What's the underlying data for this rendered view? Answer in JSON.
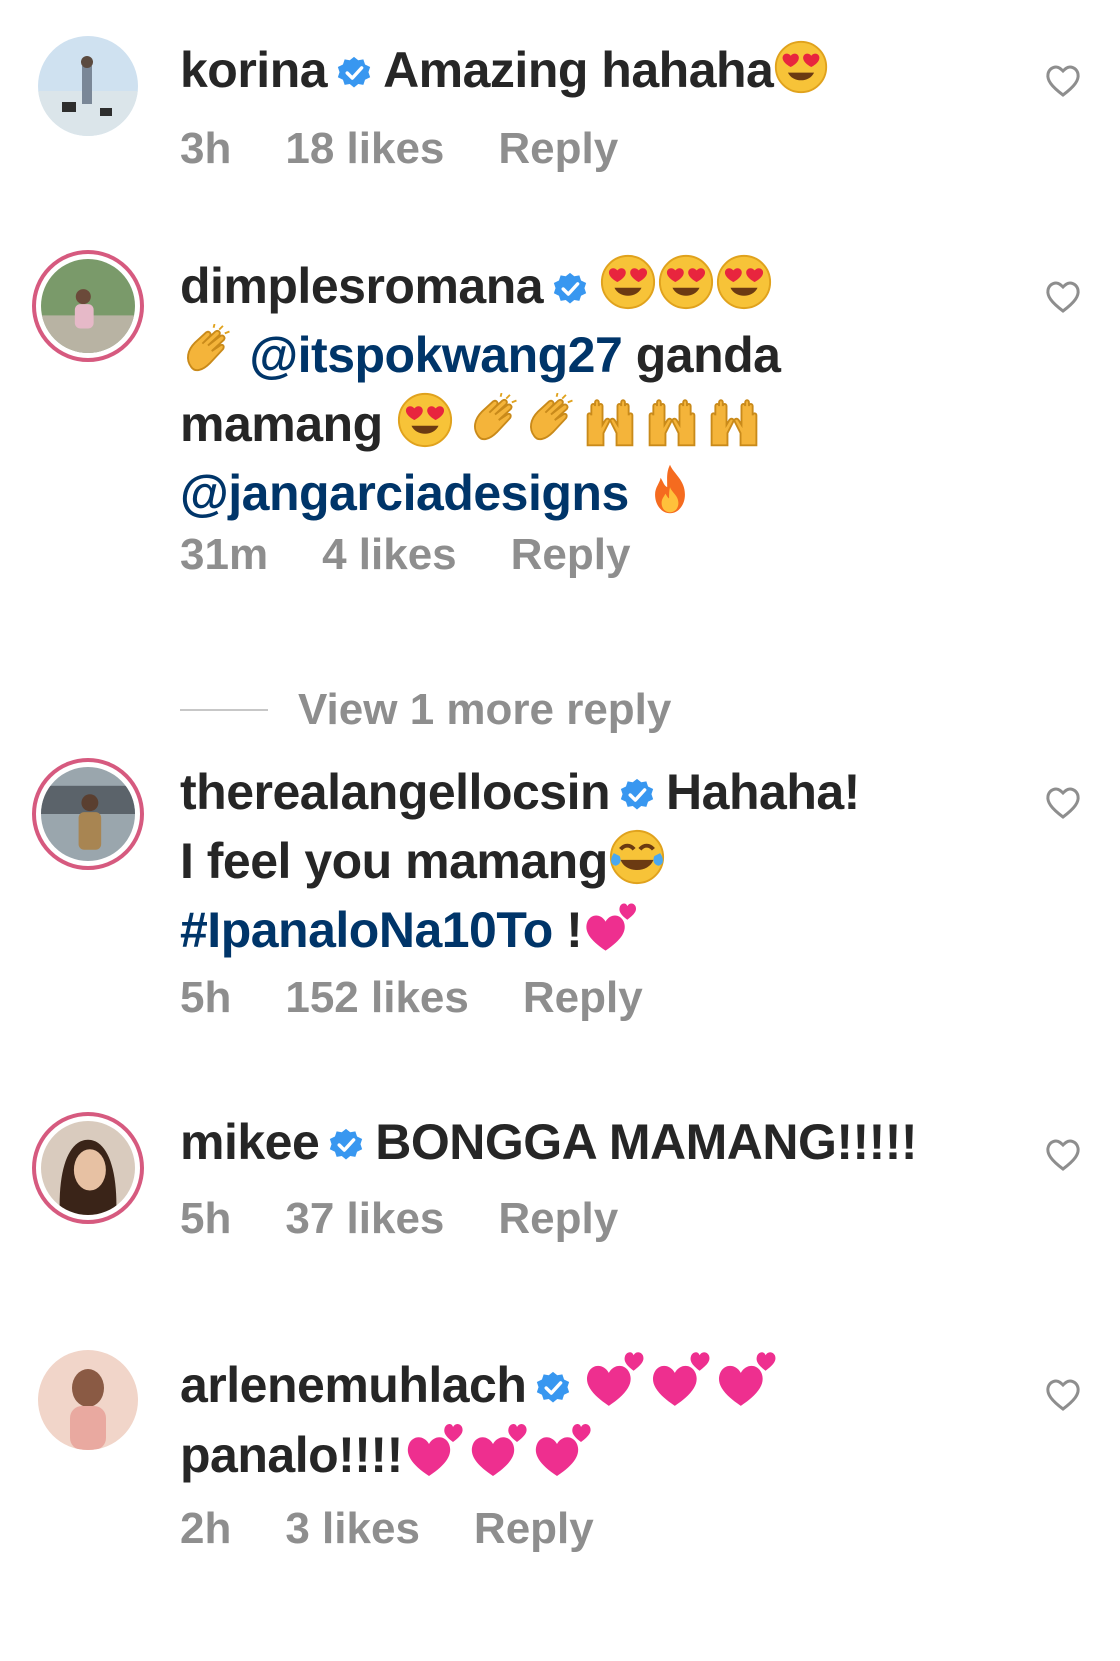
{
  "colors": {
    "meta": "#8e8e8e",
    "mention": "#003569",
    "verified": "#3897f0",
    "ring": "#d65a7f"
  },
  "comments": [
    {
      "username": "korina",
      "text": "Amazing hahaha",
      "emoji": [
        "heart-eyes"
      ],
      "time": "3h",
      "likes": "18 likes",
      "reply": "Reply"
    },
    {
      "username": "dimplesromana",
      "emoji_lead": [
        "heart-eyes",
        "heart-eyes",
        "heart-eyes"
      ],
      "mention1": "@itspokwang27",
      "text1": "ganda",
      "text2": "mamang",
      "mention2": "@jangarciadesigns",
      "time": "31m",
      "likes": "4 likes",
      "reply": "Reply"
    },
    {
      "username": "therealangellocsin",
      "text1": "Hahaha!",
      "text2": "I feel you mamang",
      "hashtag": "#IpanaloNa10To",
      "text3": "!",
      "time": "5h",
      "likes": "152 likes",
      "reply": "Reply"
    },
    {
      "username": "mikee",
      "text": "BONGGA MAMANG!!!!!",
      "time": "5h",
      "likes": "37 likes",
      "reply": "Reply"
    },
    {
      "username": "arlenemuhlach",
      "text": "panalo!!!!",
      "time": "2h",
      "likes": "3 likes",
      "reply": "Reply"
    }
  ],
  "view_more": "View 1 more reply"
}
